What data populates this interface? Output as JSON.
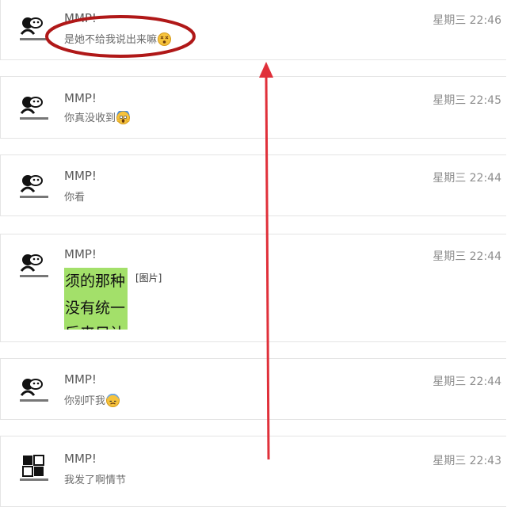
{
  "conversations": [
    {
      "name": "MMP!",
      "time": "星期三 22:46",
      "message": "是她不给我说出来嘛",
      "emoji": "dizzy-face-icon"
    },
    {
      "name": "MMP!",
      "time": "星期三 22:45",
      "message": "你真没收到",
      "emoji": "scream-face-icon"
    },
    {
      "name": "MMP!",
      "time": "星期三 22:44",
      "message": "你看"
    },
    {
      "name": "MMP!",
      "time": "星期三 22:44",
      "image_label": "[图片]",
      "image_lines": [
        "须的那种",
        "没有统一",
        "后来只让"
      ]
    },
    {
      "name": "MMP!",
      "time": "星期三 22:44",
      "message": "你别吓我",
      "emoji": "anxious-face-icon"
    },
    {
      "name": "MMP!",
      "time": "星期三 22:43",
      "message": "我发了啊情节"
    }
  ],
  "annotation": {
    "color": "#e0303a",
    "circle_color": "#b01818"
  }
}
